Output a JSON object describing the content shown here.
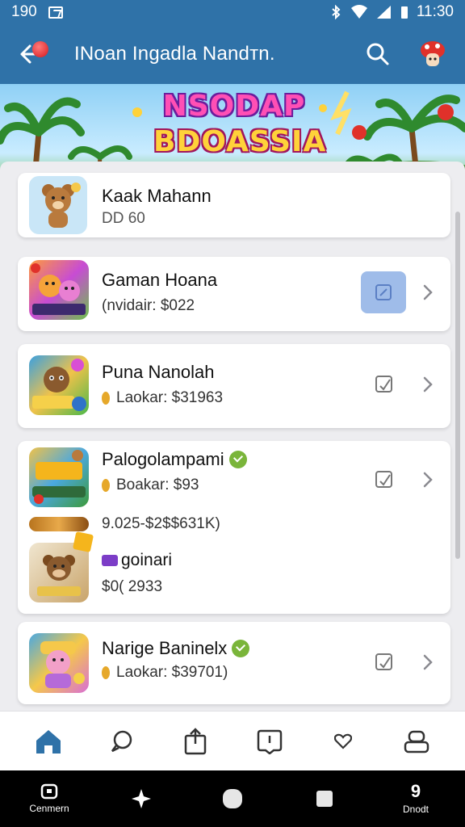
{
  "status_bar": {
    "left_text": "190",
    "right_time": "11:30"
  },
  "app_bar": {
    "title": "INoan Ingadla Nandтn."
  },
  "banner": {
    "logo_line1": "NSODAP",
    "logo_line2": "BDOASSIA"
  },
  "items": [
    {
      "title": "Kaak Mahann",
      "subtitle": "DD 60"
    },
    {
      "title": "Gaman Hoana",
      "subtitle": "(nvidair: $022"
    },
    {
      "title": "Puna Nanolah",
      "subtitle": "Laokar: $31963"
    },
    {
      "title": "Palogolampami",
      "subtitle": "Boakar: $93",
      "range_text": "9.025-$2$$631K)",
      "sub_title": "goinari",
      "sub_price": "$0( 2933"
    },
    {
      "title": "Narige Baninelx",
      "subtitle": "Laokar: $39701)"
    }
  ],
  "bottom_nav": [
    {
      "name": "home-icon",
      "active": true
    },
    {
      "name": "chat-icon"
    },
    {
      "name": "share-icon"
    },
    {
      "name": "notes-icon"
    },
    {
      "name": "heart-icon"
    },
    {
      "name": "profile-icon"
    }
  ],
  "system_nav": {
    "left_label": "Cenmern",
    "right_number": "9",
    "right_label": "Dnodt"
  },
  "colors": {
    "primary": "#2f72a8",
    "active_nav": "#2f72a8",
    "highlight": "#9fbce9",
    "coin": "#e6a82a",
    "verified": "#7ab53a"
  }
}
